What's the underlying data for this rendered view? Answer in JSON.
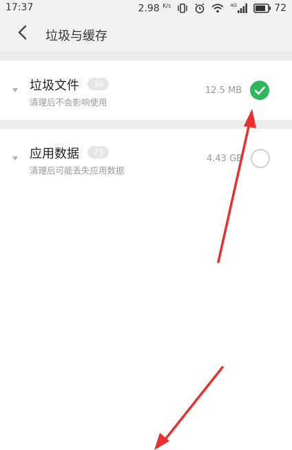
{
  "status_bar": {
    "time": "17:37",
    "speed_value": "2.98",
    "speed_unit": "K/s",
    "network": "4G",
    "battery": "72"
  },
  "header": {
    "back_icon": "chevron-left-icon",
    "title": "垃圾与缓存"
  },
  "items": [
    {
      "title": "垃圾文件",
      "badge": "36",
      "subtitle": "清理后不会影响使用",
      "size": "12.5 MB",
      "checked": true
    },
    {
      "title": "应用数据",
      "badge": "73",
      "subtitle": "清理后可能丢失应用数据",
      "size": "4.43 GB",
      "checked": false
    }
  ],
  "colors": {
    "check_on": "#2fb760",
    "annotation_arrow": "#e8312f"
  }
}
